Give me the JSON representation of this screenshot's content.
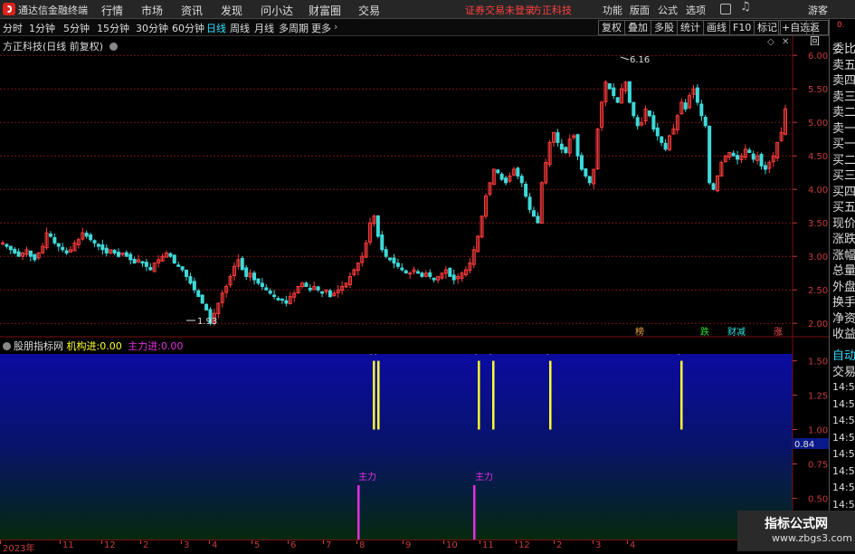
{
  "app": {
    "name": "通达信金融终端",
    "menu": [
      "行情",
      "市场",
      "资讯",
      "发现",
      "问小达",
      "财富圈",
      "交易"
    ],
    "status": "证券交易未登录",
    "broker": "方正科技",
    "right_menu": [
      "功能",
      "版面",
      "公式",
      "选项"
    ],
    "guest": "游客"
  },
  "toolbar": {
    "periods": [
      "分时",
      "1分钟",
      "5分钟",
      "15分钟",
      "30分钟",
      "60分钟",
      "日线",
      "周线",
      "月线",
      "多周期",
      "更多"
    ],
    "active": "日线",
    "right_buttons": [
      "复权",
      "叠加",
      "多股",
      "统计",
      "画线",
      "F10",
      "标记",
      "+自选",
      "返回"
    ]
  },
  "chart_header": {
    "stock": "方正科技",
    "period_info": "(日线 前复权)"
  },
  "indicator_header": {
    "name": "股朋指标网",
    "item1_label": "机构进:",
    "item1_value": "0.00",
    "item2_label": "主力进:",
    "item2_value": "0.00"
  },
  "price_axis": [
    "6.00",
    "5.50",
    "5.00",
    "4.50",
    "4.00",
    "3.50",
    "3.00",
    "2.50",
    "2.00"
  ],
  "indicator_axis": [
    "1.50",
    "1.25",
    "1.00",
    "0.75",
    "0.50",
    "0.25"
  ],
  "indicator_current": "0.84",
  "annotations": {
    "high": "6.16",
    "low": "1.93"
  },
  "signals": {
    "main_force_label": "主力",
    "bottom_tags": [
      "榜",
      "跌",
      "财减",
      "涨"
    ]
  },
  "date_axis": [
    "2023年",
    "11",
    "12",
    "2",
    "3",
    "4",
    "5",
    "6",
    "7",
    "8",
    "9",
    "10",
    "11",
    "12",
    "2",
    "3",
    "4"
  ],
  "right_panel": {
    "top": "0.",
    "items": [
      "委比",
      "卖五",
      "卖四",
      "卖三",
      "卖二",
      "卖一",
      "买一",
      "买二",
      "买三",
      "买四",
      "买五",
      "现价",
      "涨跌",
      "涨幅",
      "总量",
      "外盘",
      "换手",
      "净资",
      "收益"
    ],
    "auto": "自动",
    "trade": "交易",
    "times": [
      "14:56",
      "14:56",
      "14:56",
      "14:56",
      "14:56",
      "14:56",
      "14:56",
      "14:56"
    ]
  },
  "watermark": {
    "title": "指标公式网",
    "url": "www.zbgs3.com"
  },
  "colors": {
    "up": "#ff3c3c",
    "down": "#3fd9d9",
    "grid": "#7a1010",
    "yellow": "#ffff30",
    "magenta": "#e030e0"
  },
  "chart_data": {
    "type": "candlestick",
    "ylim": [
      1.8,
      6.3
    ],
    "closes": [
      3.2,
      3.15,
      3.1,
      3.05,
      3.0,
      3.05,
      3.1,
      3.0,
      2.95,
      3.05,
      3.15,
      3.35,
      3.3,
      3.2,
      3.15,
      3.1,
      3.05,
      3.1,
      3.2,
      3.25,
      3.35,
      3.3,
      3.25,
      3.2,
      3.15,
      3.1,
      3.05,
      3.1,
      3.05,
      3.0,
      3.05,
      3.0,
      2.95,
      2.9,
      2.95,
      2.9,
      2.85,
      2.8,
      2.9,
      2.95,
      3.0,
      3.05,
      3.0,
      2.9,
      2.85,
      2.8,
      2.7,
      2.6,
      2.5,
      2.4,
      2.3,
      2.2,
      2.0,
      2.15,
      2.3,
      2.45,
      2.55,
      2.7,
      2.85,
      2.95,
      2.8,
      2.7,
      2.75,
      2.65,
      2.6,
      2.55,
      2.5,
      2.45,
      2.4,
      2.35,
      2.35,
      2.3,
      2.4,
      2.45,
      2.55,
      2.6,
      2.55,
      2.5,
      2.55,
      2.5,
      2.45,
      2.5,
      2.4,
      2.45,
      2.5,
      2.55,
      2.6,
      2.7,
      2.8,
      2.9,
      3.0,
      3.2,
      3.5,
      3.6,
      3.3,
      3.1,
      3.0,
      2.95,
      2.9,
      2.85,
      2.8,
      2.75,
      2.75,
      2.8,
      2.75,
      2.7,
      2.75,
      2.7,
      2.65,
      2.7,
      2.75,
      2.8,
      2.7,
      2.65,
      2.7,
      2.75,
      2.8,
      2.9,
      3.1,
      3.3,
      3.6,
      3.9,
      4.1,
      4.3,
      4.25,
      4.15,
      4.1,
      4.2,
      4.3,
      4.2,
      4.1,
      3.9,
      3.7,
      3.6,
      3.5,
      4.1,
      4.4,
      4.7,
      4.85,
      4.7,
      4.6,
      4.55,
      4.75,
      4.8,
      4.5,
      4.3,
      4.2,
      4.1,
      4.3,
      4.9,
      5.3,
      5.6,
      5.5,
      5.4,
      5.3,
      5.5,
      5.6,
      5.3,
      5.1,
      4.95,
      5.0,
      5.2,
      5.1,
      4.9,
      4.8,
      4.7,
      4.6,
      4.8,
      4.9,
      5.1,
      5.3,
      5.2,
      5.4,
      5.5,
      5.3,
      5.1,
      4.95,
      4.1,
      4.0,
      4.2,
      4.4,
      4.5,
      4.55,
      4.5,
      4.45,
      4.5,
      4.6,
      4.55,
      4.45,
      4.5,
      4.35,
      4.3,
      4.4,
      4.5,
      4.7,
      4.85,
      5.2
    ]
  }
}
